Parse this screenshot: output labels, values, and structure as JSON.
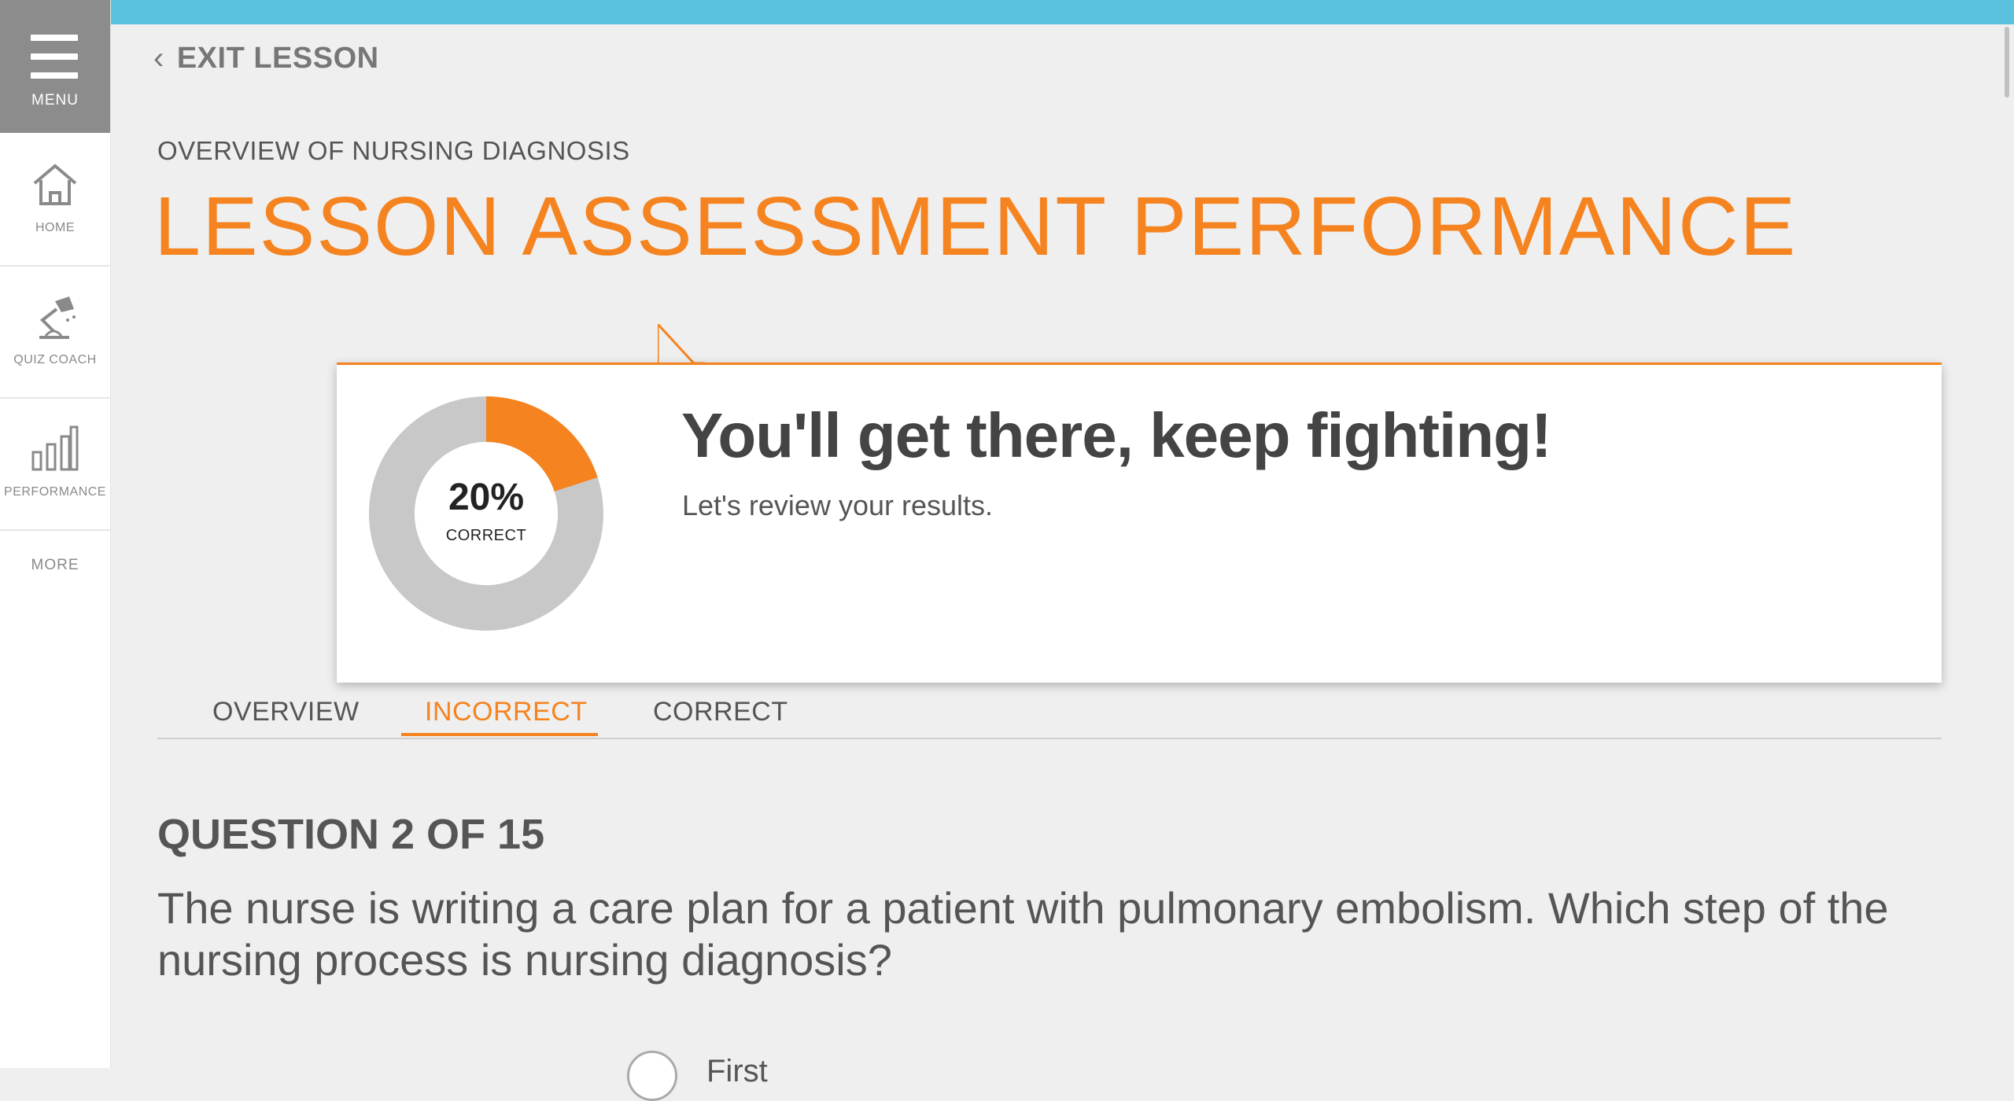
{
  "colors": {
    "accent": "#f5831f",
    "topbar": "#5bc1df",
    "donut_track": "#c8c8c8"
  },
  "sidebar": {
    "menu_label": "MENU",
    "items": [
      {
        "label": "HOME",
        "icon": "home-icon"
      },
      {
        "label": "QUIZ COACH",
        "icon": "desk-lamp-icon"
      },
      {
        "label": "PERFORMANCE",
        "icon": "bar-chart-icon"
      }
    ],
    "more_label": "MORE"
  },
  "header": {
    "exit_label": "EXIT LESSON",
    "subtitle": "OVERVIEW OF NURSING DIAGNOSIS",
    "title": "LESSON ASSESSMENT PERFORMANCE"
  },
  "result": {
    "percent_value": 20,
    "percent_text": "20%",
    "percent_label": "CORRECT",
    "headline": "You'll get there, keep fighting!",
    "subline": "Let's review your results."
  },
  "tabs": [
    {
      "label": "OVERVIEW",
      "active": false
    },
    {
      "label": "INCORRECT",
      "active": true
    },
    {
      "label": "CORRECT",
      "active": false
    }
  ],
  "question": {
    "number": "QUESTION 2 OF 15",
    "text": "The nurse is writing a care plan for a patient with pulmonary embolism. Which step of the nursing process is nursing diagnosis?",
    "first_option": "First"
  }
}
